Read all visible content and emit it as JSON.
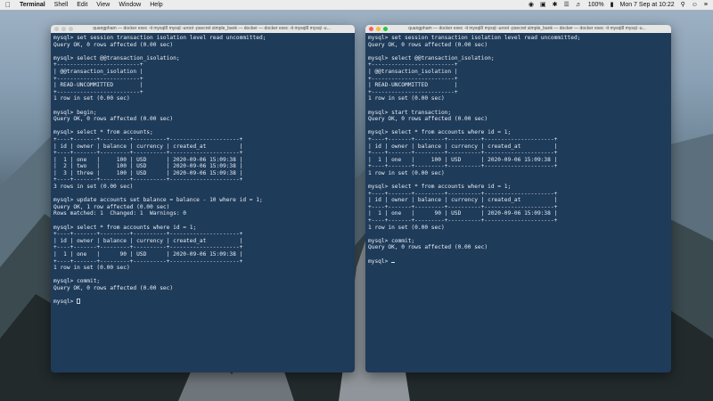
{
  "menubar": {
    "app": "Terminal",
    "items": [
      "Shell",
      "Edit",
      "View",
      "Window",
      "Help"
    ],
    "clock": "Mon 7 Sep at 10:22",
    "battery": "100%"
  },
  "left": {
    "title": "quangpham — docker exec -it mysql8 mysql -uroot -psecret simple_bank — docker — docker exec -it mysql8 mysql -u...",
    "lines": [
      "mysql> set session transaction isolation level read uncommitted;",
      "Query OK, 0 rows affected (0.00 sec)",
      "",
      "mysql> select @@transaction_isolation;",
      "+-------------------------+",
      "| @@transaction_isolation |",
      "+-------------------------+",
      "| READ-UNCOMMITTED        |",
      "+-------------------------+",
      "1 row in set (0.00 sec)",
      "",
      "mysql> begin;",
      "Query OK, 0 rows affected (0.00 sec)",
      "",
      "mysql> select * from accounts;",
      "+----+-------+---------+----------+---------------------+",
      "| id | owner | balance | currency | created_at          |",
      "+----+-------+---------+----------+---------------------+",
      "|  1 | one   |     100 | USD      | 2020-09-06 15:09:38 |",
      "|  2 | two   |     100 | USD      | 2020-09-06 15:09:38 |",
      "|  3 | three |     100 | USD      | 2020-09-06 15:09:38 |",
      "+----+-------+---------+----------+---------------------+",
      "3 rows in set (0.00 sec)",
      "",
      "mysql> update accounts set balance = balance - 10 where id = 1;",
      "Query OK, 1 row affected (0.00 sec)",
      "Rows matched: 1  Changed: 1  Warnings: 0",
      "",
      "mysql> select * from accounts where id = 1;",
      "+----+-------+---------+----------+---------------------+",
      "| id | owner | balance | currency | created_at          |",
      "+----+-------+---------+----------+---------------------+",
      "|  1 | one   |      90 | USD      | 2020-09-06 15:09:38 |",
      "+----+-------+---------+----------+---------------------+",
      "1 row in set (0.00 sec)",
      "",
      "mysql> commit;",
      "Query OK, 0 rows affected (0.00 sec)",
      "",
      "mysql> "
    ]
  },
  "right": {
    "title": "quangpham — docker exec -it mysql8 mysql -uroot -psecret simple_bank — docker — docker exec -it mysql8 mysql -u...",
    "lines": [
      "mysql> set session transaction isolation level read uncommitted;",
      "Query OK, 0 rows affected (0.00 sec)",
      "",
      "mysql> select @@transaction_isolation;",
      "+-------------------------+",
      "| @@transaction_isolation |",
      "+-------------------------+",
      "| READ-UNCOMMITTED        |",
      "+-------------------------+",
      "1 row in set (0.00 sec)",
      "",
      "mysql> start transaction;",
      "Query OK, 0 rows affected (0.00 sec)",
      "",
      "mysql> select * from accounts where id = 1;",
      "+----+-------+---------+----------+---------------------+",
      "| id | owner | balance | currency | created_at          |",
      "+----+-------+---------+----------+---------------------+",
      "|  1 | one   |     100 | USD      | 2020-09-06 15:09:38 |",
      "+----+-------+---------+----------+---------------------+",
      "1 row in set (0.00 sec)",
      "",
      "mysql> select * from accounts where id = 1;",
      "+----+-------+---------+----------+---------------------+",
      "| id | owner | balance | currency | created_at          |",
      "+----+-------+---------+----------+---------------------+",
      "|  1 | one   |      90 | USD      | 2020-09-06 15:09:38 |",
      "+----+-------+---------+----------+---------------------+",
      "1 row in set (0.00 sec)",
      "",
      "mysql> commit;",
      "Query OK, 0 rows affected (0.00 sec)",
      "",
      "mysql> "
    ]
  }
}
